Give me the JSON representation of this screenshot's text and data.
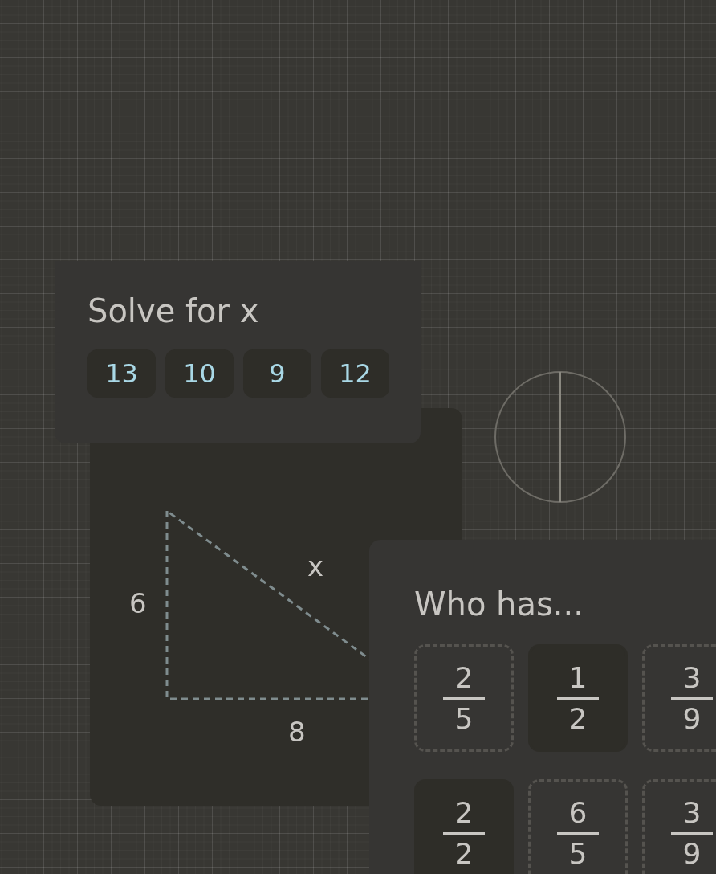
{
  "solve_card": {
    "title": "Solve for x",
    "options": [
      "13",
      "10",
      "9",
      "12"
    ]
  },
  "triangle_card": {
    "side_a": "6",
    "side_b": "8",
    "hypotenuse": "x"
  },
  "who_has_card": {
    "title": "Who has...",
    "tiles": [
      {
        "numerator": "2",
        "denominator": "5",
        "selected": false
      },
      {
        "numerator": "1",
        "denominator": "2",
        "selected": true
      },
      {
        "numerator": "3",
        "denominator": "9",
        "selected": false
      },
      {
        "numerator": "2",
        "denominator": "2",
        "selected": true
      },
      {
        "numerator": "6",
        "denominator": "5",
        "selected": false
      },
      {
        "numerator": "3",
        "denominator": "9",
        "selected": false
      }
    ]
  }
}
